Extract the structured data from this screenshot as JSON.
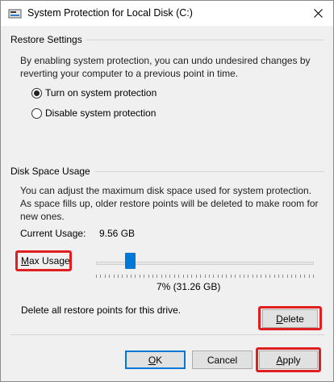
{
  "window": {
    "title": "System Protection for Local Disk (C:)"
  },
  "restore_settings": {
    "group_label": "Restore Settings",
    "description": "By enabling system protection, you can undo undesired changes by reverting your computer to a previous point in time.",
    "option_on": "Turn on system protection",
    "option_off": "Disable system protection",
    "selected": "on"
  },
  "disk_space": {
    "group_label": "Disk Space Usage",
    "description": "You can adjust the maximum disk space used for system protection. As space fills up, older restore points will be deleted to make room for new ones.",
    "current_usage_label": "Current Usage:",
    "current_usage_value": "9.56 GB",
    "max_usage_label_underlined": "M",
    "max_usage_label_rest": "ax Usage:",
    "slider_percent": 7,
    "slider_value_text": "7% (31.26 GB)",
    "delete_description": "Delete all restore points for this drive.",
    "delete_button": {
      "underlined": "D",
      "rest": "elete"
    }
  },
  "footer": {
    "ok_button": {
      "underlined": "O",
      "rest": "K"
    },
    "cancel_button": "Cancel",
    "apply_button": {
      "underlined": "A",
      "rest": "pply"
    }
  },
  "colors": {
    "highlight": "#e02020",
    "accent": "#0078d7"
  },
  "icons": {
    "title": "drive-icon",
    "close": "close-icon"
  }
}
